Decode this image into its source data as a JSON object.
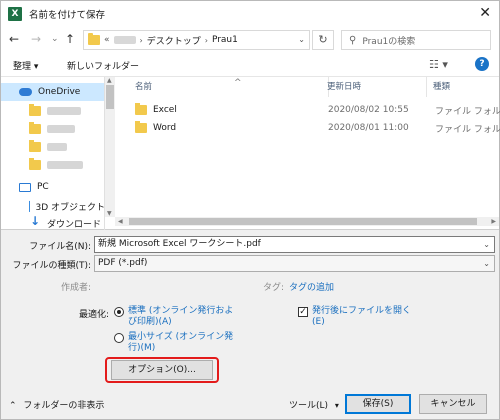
{
  "window": {
    "title": "名前を付けて保存",
    "app_icon": "X",
    "close": "✕"
  },
  "nav": {
    "back": "←",
    "forward": "→",
    "dropdown": "⌄",
    "up": "↑",
    "breadcrumb_overflow": "«",
    "breadcrumb": [
      "デスクトップ",
      "Prau1"
    ],
    "refresh": "↻",
    "search_placeholder": "Prau1の検索"
  },
  "toolbar": {
    "organize": "整理 ▾",
    "new_folder": "新しいフォルダー",
    "view": "☷ ▾",
    "help": "?"
  },
  "navpane": {
    "onedrive": "OneDrive",
    "pc": "PC",
    "objects3d": "3D オブジェクト",
    "downloads": "ダウンロード"
  },
  "columns": {
    "name": "名前",
    "date": "更新日時",
    "type": "種類"
  },
  "files": [
    {
      "name": "Excel",
      "date": "2020/08/02 10:55",
      "type": "ファイル フォルダー"
    },
    {
      "name": "Word",
      "date": "2020/08/01 11:00",
      "type": "ファイル フォルダー"
    }
  ],
  "form": {
    "filename_label": "ファイル名(N):",
    "filename_value": "新規 Microsoft Excel ワークシート.pdf",
    "filetype_label": "ファイルの種類(T):",
    "filetype_value": "PDF (*.pdf)",
    "author_label": "作成者:",
    "tags_label": "タグ:",
    "tags_link": "タグの追加",
    "optimize_label": "最適化:",
    "opt_standard_1": "標準 (オンライン発行およ",
    "opt_standard_2": "び印刷)(A)",
    "opt_min_1": "最小サイズ (オンライン発",
    "opt_min_2": "行)(M)",
    "open_after_1": "発行後にファイルを開く",
    "open_after_2": "(E)",
    "options_button": "オプション(O)..."
  },
  "footer": {
    "hide_folders": "フォルダーの非表示",
    "tools": "ツール(L)",
    "save": "保存(S)",
    "cancel": "キャンセル"
  },
  "colors": {
    "accent": "#0078d7",
    "highlight": "#e31b1b",
    "excel": "#1e7145"
  }
}
